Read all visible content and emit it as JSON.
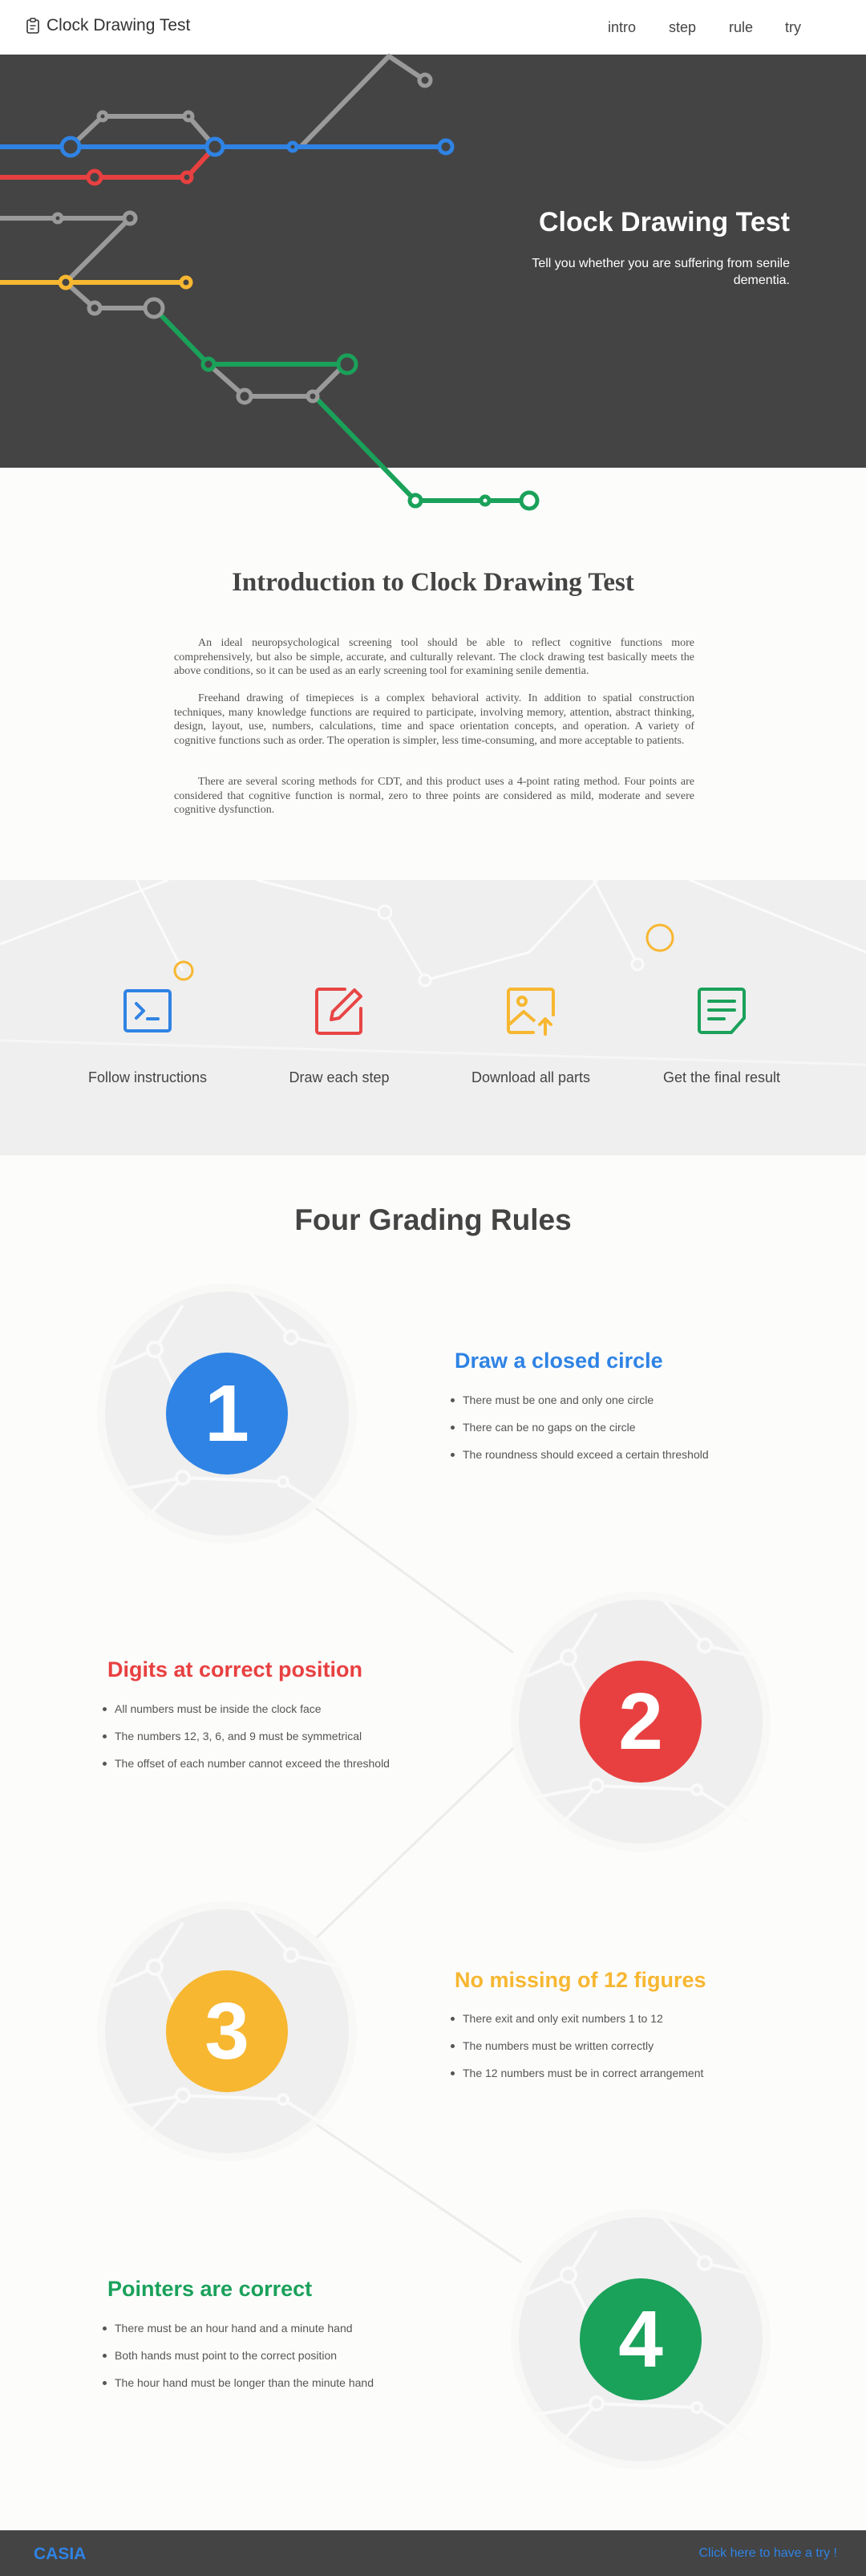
{
  "nav": {
    "brand": "Clock Drawing Test",
    "brand_icon": "clipboard-icon",
    "links": [
      "intro",
      "step",
      "rule",
      "try"
    ]
  },
  "hero": {
    "title": "Clock Drawing Test",
    "subtitle": "Tell you whether you are suffering from senile dementia."
  },
  "intro": {
    "title": "Introduction to Clock Drawing Test",
    "paragraphs": [
      "An ideal neuropsychological screening tool should be able to reflect cognitive functions more comprehensively, but also be simple, accurate, and culturally relevant. The clock drawing test basically meets the above conditions, so it can be used as an early screening tool for examining senile dementia.",
      "Freehand drawing of timepieces is a complex behavioral activity. In addition to spatial construction techniques, many knowledge functions are required to participate, involving memory, attention, abstract thinking, design, layout, use, numbers, calculations, time and space orientation concepts, and operation. A variety of cognitive functions such as order. The operation is simpler, less time-consuming, and more acceptable to patients.",
      "There are several scoring methods for CDT, and this product uses a 4-point rating method. Four points are considered that cognitive function is normal, zero to three points are considered as mild, moderate and severe cognitive dysfunction."
    ]
  },
  "steps": [
    {
      "label": "Follow instructions",
      "icon": "terminal-icon",
      "color": "#2f83e4"
    },
    {
      "label": "Draw each step",
      "icon": "edit-icon",
      "color": "#e84545"
    },
    {
      "label": "Download all parts",
      "icon": "image-upload-icon",
      "color": "#f7b731"
    },
    {
      "label": "Get the final result",
      "icon": "document-icon",
      "color": "#1aa15a"
    }
  ],
  "rules": {
    "title": "Four Grading Rules",
    "items": [
      {
        "number": "1",
        "heading": "Draw a closed circle",
        "color": "#2f83e4",
        "points": [
          "There must be one and only one circle",
          "There can be no gaps on the circle",
          "The roundness should exceed a certain threshold"
        ]
      },
      {
        "number": "2",
        "heading": "Digits at correct position",
        "color": "#e84040",
        "points": [
          "All numbers must be inside the clock face",
          "The numbers 12, 3, 6, and 9 must be symmetrical",
          "The offset of each number cannot exceed the threshold"
        ]
      },
      {
        "number": "3",
        "heading": "No missing of 12 figures",
        "color": "#f7b731",
        "points": [
          "There exit and only exit numbers 1 to 12",
          "The numbers must be written correctly",
          "The 12 numbers must be in correct arrangement"
        ]
      },
      {
        "number": "4",
        "heading": "Pointers are correct",
        "color": "#1aa15a",
        "points": [
          "There must be an hour hand and a minute hand",
          "Both hands must point to the correct position",
          "The hour hand must be longer than the minute hand"
        ]
      }
    ]
  },
  "footer": {
    "brand": "CASIA",
    "cta": "Click here to have a try !"
  },
  "colors": {
    "blue": "#2f83e4",
    "red": "#e84040",
    "yellow": "#f7b731",
    "green": "#1aa15a",
    "gray": "#9a9a9a",
    "dark": "#444444"
  }
}
